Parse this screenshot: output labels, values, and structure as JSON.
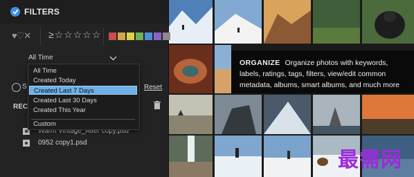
{
  "filters": {
    "title": "FILTERS",
    "hearts": "♥♡✕",
    "stars_prefix": "≥",
    "stars": "☆☆☆☆☆",
    "color_labels": [
      "#c94d4d",
      "#d4a64a",
      "#d9d24a",
      "#6fb25a",
      "#4f8fd6",
      "#8c62c8",
      "#8a8a8a"
    ]
  },
  "time_filter": {
    "selected": "All Time",
    "options": [
      "All Time",
      "Created Today",
      "Created Last 7 Days",
      "Created Last 30 Days",
      "Created This Year",
      "Custom"
    ],
    "highlighted_index": 2
  },
  "search": {
    "label": "S",
    "reset_label": "Reset"
  },
  "recent": {
    "heading": "RECE",
    "files": [
      "Warm Vintage_Alter copy.psd",
      "0952 copy1.psd"
    ]
  },
  "banner": {
    "heading": "ORGANIZE",
    "body": "Organize photos with keywords, labels, ratings, tags, filters, view/edit common metadata, albums, smart albums, and much more"
  },
  "watermark": "最需网",
  "accent_color": "#3d8ee6"
}
